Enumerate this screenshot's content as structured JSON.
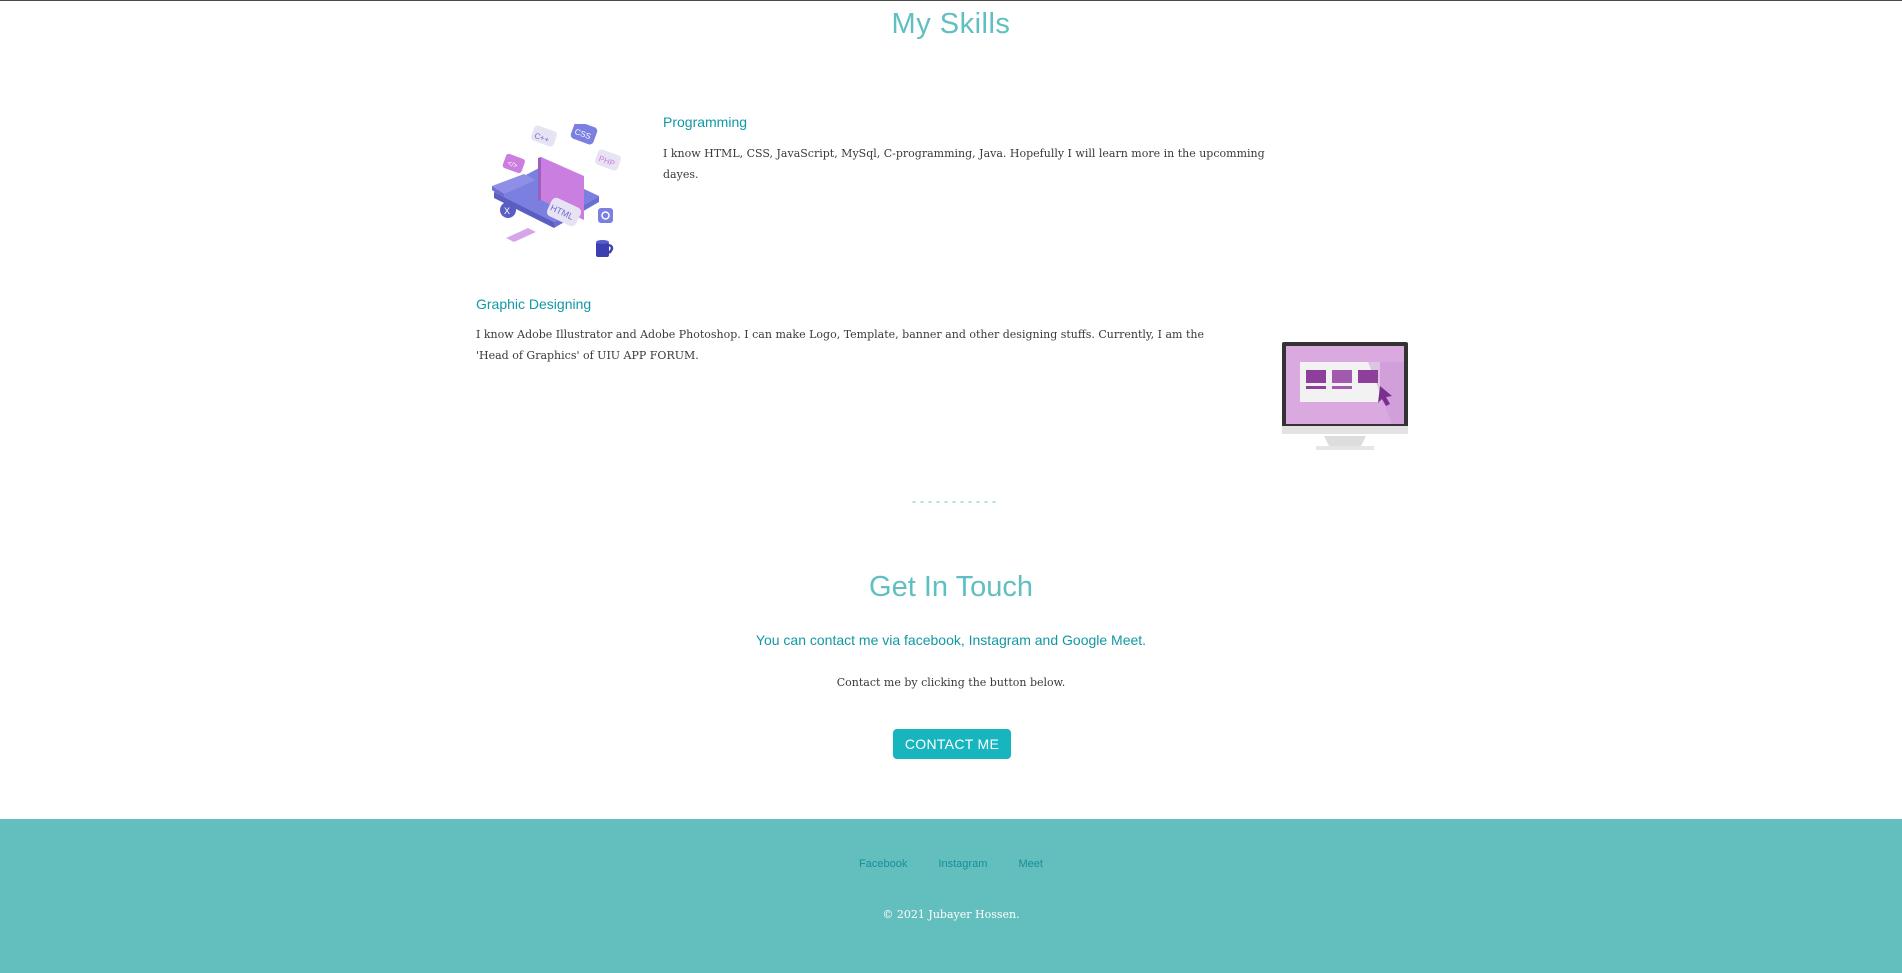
{
  "skills": {
    "title": "My Skills",
    "programming": {
      "heading": "Programming",
      "text": "I know HTML, CSS, JavaScript, MySql, C-programming, Java. Hopefully I will learn more in the upcomming dayes."
    },
    "graphic": {
      "heading": "Graphic Designing",
      "text": "I know Adobe Illustrator and Adobe Photoshop. I can make Logo, Template, banner and other designing stuffs. Currently, I am the 'Head of Graphics' of UIU APP FORUM."
    },
    "illustration_labels": [
      "C++",
      "CSS",
      "PHP",
      "HTML"
    ]
  },
  "contact": {
    "title": "Get In Touch",
    "subtitle": "You can contact me via facebook, Instagram and Google Meet.",
    "text": "Contact me by clicking the button below.",
    "button_label": "CONTACT ME"
  },
  "footer": {
    "links": [
      "Facebook",
      "Instagram",
      "Meet"
    ],
    "copyright": "© 2021 Jubayer Hossen."
  },
  "colors": {
    "accent": "#5fbfc1",
    "heading": "#1198a6",
    "button": "#17b5bd",
    "footer_bg": "#63bebe"
  }
}
